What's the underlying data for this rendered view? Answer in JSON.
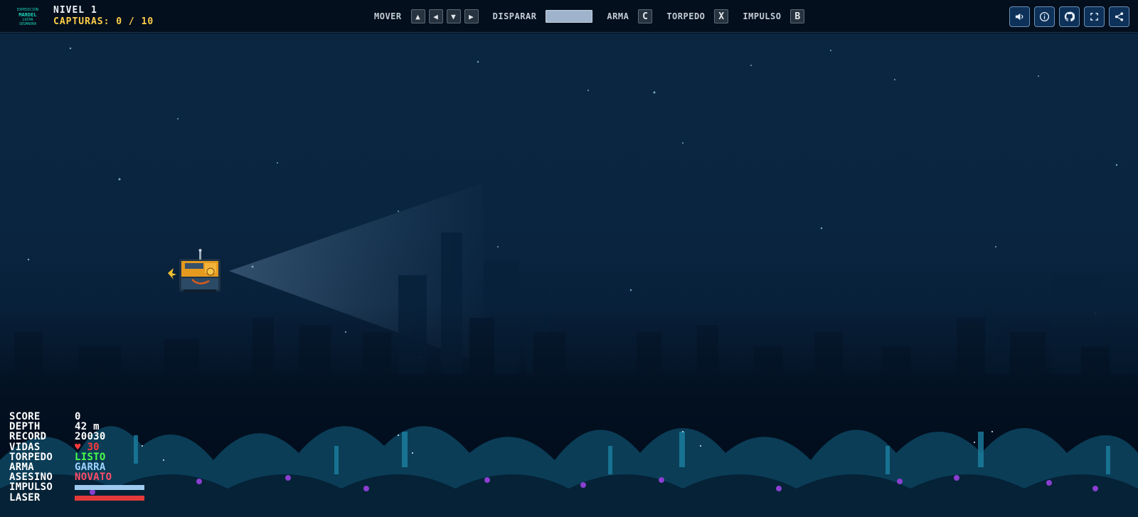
{
  "header": {
    "logo_lines": [
      "EXPEDICIÓN",
      "MARDEL",
      "LUCHA",
      "SEGMADRA"
    ],
    "level": "NIVEL 1",
    "captures": "CAPTURAS: 0 / 10"
  },
  "controls": {
    "move_label": "MOVER",
    "move_keys": [
      "▲",
      "◀",
      "▼",
      "▶"
    ],
    "fire_label": "DISPARAR",
    "weapon_label": "ARMA",
    "weapon_key": "C",
    "torpedo_label": "TORPEDO",
    "torpedo_key": "X",
    "boost_label": "IMPULSO",
    "boost_key": "B"
  },
  "toolbar": {
    "buttons": [
      "sound-icon",
      "info-icon",
      "github-icon",
      "fullscreen-icon",
      "share-icon"
    ]
  },
  "hud": {
    "score_label": "SCORE",
    "score": "0",
    "depth_label": "DEPTH",
    "depth": "42 m",
    "record_label": "RECORD",
    "record": "20030",
    "lives_label": "VIDAS",
    "lives": "♥ 30",
    "torpedo_label": "TORPEDO",
    "torpedo": "LISTO",
    "weapon_label": "ARMA",
    "weapon": "GARRA",
    "killer_label": "ASESINO",
    "killer": "NOVATO",
    "boost_label": "IMPULSO",
    "boost_level": 1.0,
    "laser_label": "LASER",
    "laser_level": 1.0
  },
  "colors": {
    "captures": "#ffcf4a",
    "lives": "#ff3b3b",
    "torpedo_ready": "#4aff4a",
    "weapon": "#9fd4ff",
    "rank": "#ff4d6a",
    "boost_bar": "#9fcbee",
    "laser_bar": "#e53a3a"
  }
}
